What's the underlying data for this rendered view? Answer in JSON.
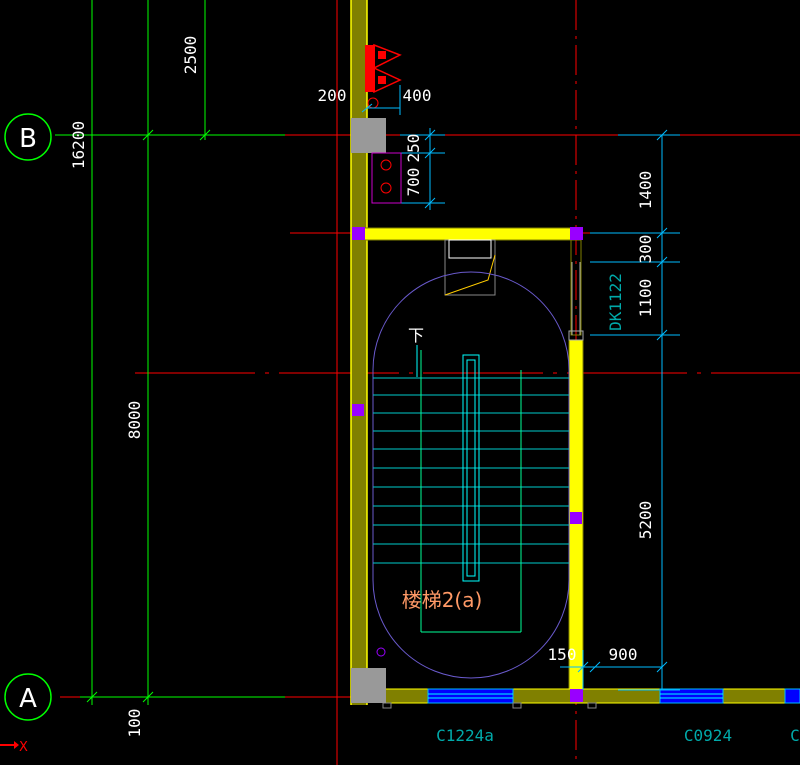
{
  "axes": {
    "axis_b": "B",
    "axis_a": "A"
  },
  "dimensions_left": {
    "total": "16200",
    "upper": "2500",
    "span": "8000",
    "lower": "100"
  },
  "dimensions_top": {
    "wall_left": "200",
    "wall_right": "400",
    "d250": "250",
    "d700": "700"
  },
  "dimensions_right": {
    "d1400": "1400",
    "d300": "300",
    "d1100": "1100",
    "d5200": "5200"
  },
  "dimensions_bottom": {
    "d150": "150",
    "d900": "900"
  },
  "labels": {
    "door": "DK1122",
    "stair_down": "下",
    "stair_name": "楼梯2(a)",
    "window1": "C1224a",
    "window2": "C0924",
    "window3": "C"
  },
  "ucs": {
    "x_label": "X"
  },
  "colors": {
    "background": "#000000",
    "wall_fill": "#ffff00",
    "wall_olive": "#808000",
    "column": "#9900ff",
    "axis_line": "#ff0000",
    "axis_bubble": "#00ff00",
    "dim_line": "#00ff00",
    "dim_text": "#ffffff",
    "stair": "#00ffff",
    "window": "#0000ff",
    "door_dim": "#00bbbb",
    "stair_label": "#ff9966"
  }
}
